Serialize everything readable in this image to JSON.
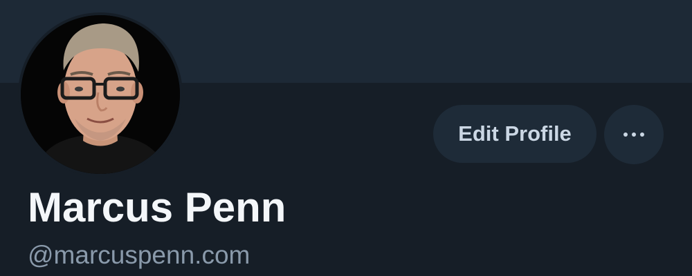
{
  "profile": {
    "display_name": "Marcus Penn",
    "handle": "@marcuspenn.com",
    "avatar_icon": "user-avatar-photo"
  },
  "actions": {
    "edit_label": "Edit Profile",
    "more_icon": "more-horizontal-icon"
  },
  "colors": {
    "background": "#161e27",
    "banner": "#1d2936",
    "button_bg": "#1e2b38",
    "button_text": "#cbd7e4",
    "name_text": "#f4f7fa",
    "handle_text": "#8a9aab"
  }
}
